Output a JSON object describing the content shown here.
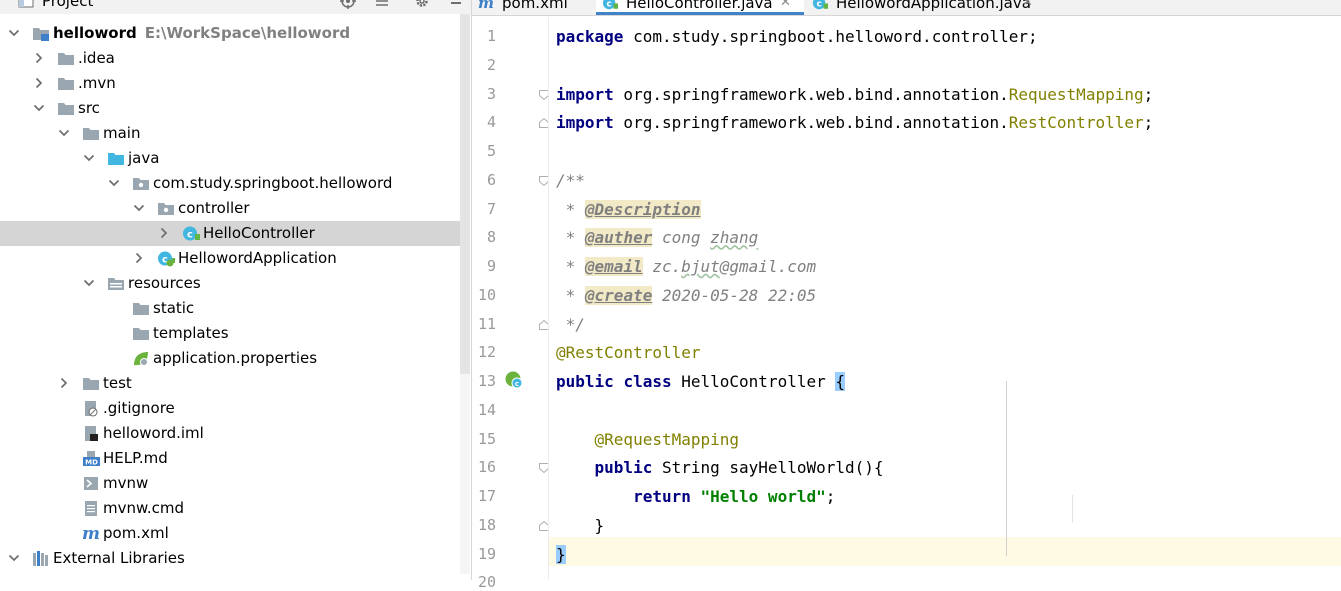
{
  "project_panel": {
    "title": "Project",
    "tree": [
      {
        "label": "helloword",
        "path": "E:\\WorkSpace\\helloword",
        "icon": "module-folder-icon",
        "arrow": "down",
        "indent": 0,
        "bold": true
      },
      {
        "label": ".idea",
        "icon": "folder-icon",
        "arrow": "right",
        "indent": 1
      },
      {
        "label": ".mvn",
        "icon": "folder-icon",
        "arrow": "right",
        "indent": 1
      },
      {
        "label": "src",
        "icon": "folder-icon",
        "arrow": "down",
        "indent": 1
      },
      {
        "label": "main",
        "icon": "folder-icon",
        "arrow": "down",
        "indent": 2
      },
      {
        "label": "java",
        "icon": "source-folder-icon",
        "arrow": "down",
        "indent": 3
      },
      {
        "label": "com.study.springboot.helloword",
        "icon": "package-icon",
        "arrow": "down",
        "indent": 4
      },
      {
        "label": "controller",
        "icon": "package-icon",
        "arrow": "down",
        "indent": 5
      },
      {
        "label": "HelloController",
        "icon": "java-class-icon",
        "arrow": "right",
        "indent": 6,
        "selected": true
      },
      {
        "label": "HellowordApplication",
        "icon": "spring-boot-class-icon",
        "arrow": "right",
        "indent": 5
      },
      {
        "label": "resources",
        "icon": "resources-folder-icon",
        "arrow": "down",
        "indent": 3
      },
      {
        "label": "static",
        "icon": "folder-icon",
        "arrow": "none",
        "indent": 4
      },
      {
        "label": "templates",
        "icon": "folder-icon",
        "arrow": "none",
        "indent": 4
      },
      {
        "label": "application.properties",
        "icon": "spring-properties-icon",
        "arrow": "none",
        "indent": 4
      },
      {
        "label": "test",
        "icon": "folder-icon",
        "arrow": "right",
        "indent": 2
      },
      {
        "label": ".gitignore",
        "icon": "ignore-file-icon",
        "arrow": "none",
        "indent": 2
      },
      {
        "label": "helloword.iml",
        "icon": "iml-file-icon",
        "arrow": "none",
        "indent": 2
      },
      {
        "label": "HELP.md",
        "icon": "markdown-file-icon",
        "arrow": "none",
        "indent": 2
      },
      {
        "label": "mvnw",
        "icon": "script-file-icon",
        "arrow": "none",
        "indent": 2
      },
      {
        "label": "mvnw.cmd",
        "icon": "text-file-icon",
        "arrow": "none",
        "indent": 2
      },
      {
        "label": "pom.xml",
        "icon": "maven-icon",
        "arrow": "none",
        "indent": 2
      },
      {
        "label": "External Libraries",
        "icon": "libraries-icon",
        "arrow": "down",
        "indent": 0
      }
    ]
  },
  "tabs": [
    {
      "label": "pom.xml",
      "icon": "maven-icon",
      "active": false,
      "closable": false
    },
    {
      "label": "HelloController.java",
      "icon": "java-class-icon",
      "active": true,
      "closable": true
    },
    {
      "label": "HellowordApplication.java",
      "icon": "java-class-icon",
      "active": false,
      "closable": true
    }
  ],
  "editor": {
    "lines": [
      {
        "n": "1",
        "tokens": [
          {
            "t": "package",
            "c": "kw"
          },
          {
            "t": " com.study.springboot.helloword.controller;",
            "c": ""
          }
        ]
      },
      {
        "n": "2",
        "tokens": []
      },
      {
        "n": "3",
        "fold": "open",
        "tokens": [
          {
            "t": "import",
            "c": "kw"
          },
          {
            "t": " org.springframework.web.bind.annotation.",
            "c": ""
          },
          {
            "t": "RequestMapping",
            "c": "ann"
          },
          {
            "t": ";",
            "c": ""
          }
        ]
      },
      {
        "n": "4",
        "fold": "close",
        "tokens": [
          {
            "t": "import",
            "c": "kw"
          },
          {
            "t": " org.springframework.web.bind.annotation.",
            "c": ""
          },
          {
            "t": "RestController",
            "c": "ann"
          },
          {
            "t": ";",
            "c": ""
          }
        ]
      },
      {
        "n": "5",
        "tokens": []
      },
      {
        "n": "6",
        "fold": "open",
        "tokens": [
          {
            "t": "/**",
            "c": "cmt"
          }
        ]
      },
      {
        "n": "7",
        "tokens": [
          {
            "t": " * ",
            "c": "cmt"
          },
          {
            "t": "@Description",
            "c": "tag"
          }
        ]
      },
      {
        "n": "8",
        "tokens": [
          {
            "t": " * ",
            "c": "cmt"
          },
          {
            "t": "@auther",
            "c": "tag"
          },
          {
            "t": " cong ",
            "c": "cmt"
          },
          {
            "t": "zhang",
            "c": "cmt squiggle"
          }
        ]
      },
      {
        "n": "9",
        "tokens": [
          {
            "t": " * ",
            "c": "cmt"
          },
          {
            "t": "@email",
            "c": "tag"
          },
          {
            "t": " zc.",
            "c": "cmt"
          },
          {
            "t": "bjut",
            "c": "cmt squiggle"
          },
          {
            "t": "@gmail.com",
            "c": "cmt"
          }
        ]
      },
      {
        "n": "10",
        "tokens": [
          {
            "t": " * ",
            "c": "cmt"
          },
          {
            "t": "@create",
            "c": "tag"
          },
          {
            "t": " 2020-05-28 22:05",
            "c": "cmt"
          }
        ]
      },
      {
        "n": "11",
        "fold": "close",
        "tokens": [
          {
            "t": " */",
            "c": "cmt"
          }
        ]
      },
      {
        "n": "12",
        "tokens": [
          {
            "t": "@RestController",
            "c": "ann"
          }
        ]
      },
      {
        "n": "13",
        "marker": true,
        "tokens": [
          {
            "t": "public",
            "c": "kw"
          },
          {
            "t": " ",
            "c": ""
          },
          {
            "t": "class",
            "c": "kw"
          },
          {
            "t": " HelloController ",
            "c": ""
          },
          {
            "t": "{",
            "c": "brace-hl"
          }
        ]
      },
      {
        "n": "14",
        "tokens": []
      },
      {
        "n": "15",
        "tokens": [
          {
            "t": "    ",
            "c": ""
          },
          {
            "t": "@RequestMapping",
            "c": "ann"
          }
        ]
      },
      {
        "n": "16",
        "fold": "open",
        "tokens": [
          {
            "t": "    ",
            "c": ""
          },
          {
            "t": "public",
            "c": "kw"
          },
          {
            "t": " String sayHelloWorld(){",
            "c": ""
          }
        ]
      },
      {
        "n": "17",
        "tokens": [
          {
            "t": "        ",
            "c": ""
          },
          {
            "t": "return",
            "c": "kw"
          },
          {
            "t": " ",
            "c": ""
          },
          {
            "t": "\"Hello world\"",
            "c": "str"
          },
          {
            "t": ";",
            "c": ""
          }
        ]
      },
      {
        "n": "18",
        "fold": "close",
        "tokens": [
          {
            "t": "    }",
            "c": ""
          }
        ]
      },
      {
        "n": "19",
        "current": true,
        "tokens": [
          {
            "t": "}",
            "c": "brace-hl"
          }
        ]
      },
      {
        "n": "20",
        "tokens": []
      }
    ]
  }
}
